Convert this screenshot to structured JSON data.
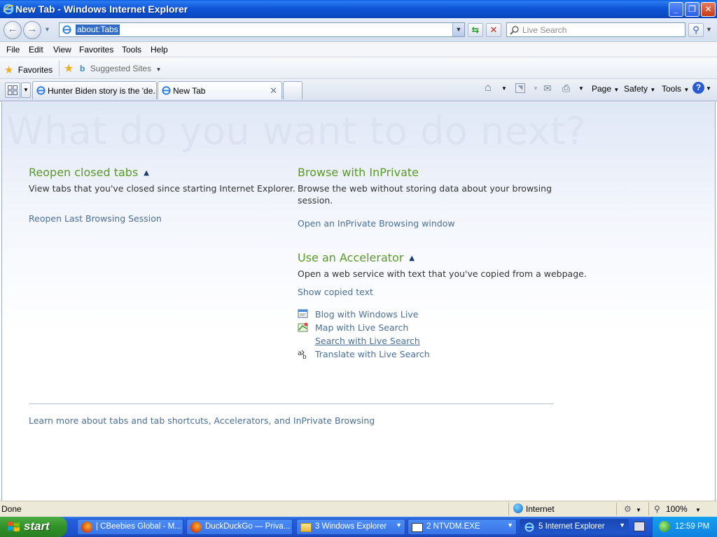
{
  "window": {
    "title": "New Tab - Windows Internet Explorer"
  },
  "address": {
    "url": "about:Tabs"
  },
  "search": {
    "placeholder": "Live Search"
  },
  "menu": [
    "File",
    "Edit",
    "View",
    "Favorites",
    "Tools",
    "Help"
  ],
  "favorites_bar": {
    "favorites_label": "Favorites",
    "suggested_sites": "Suggested Sites"
  },
  "tabs": [
    {
      "label": "Hunter Biden story is the 'de...",
      "active": false
    },
    {
      "label": "New Tab",
      "active": true
    }
  ],
  "commandbar": {
    "page": "Page",
    "safety": "Safety",
    "tools": "Tools"
  },
  "content": {
    "heading": "What do you want to do next?",
    "reopen": {
      "title": "Reopen closed tabs",
      "text": "View tabs that you've closed since starting Internet Explorer.",
      "link": "Reopen Last Browsing Session"
    },
    "inprivate": {
      "title": "Browse with InPrivate",
      "text_line1": "Browse the web without storing data about your browsing",
      "text_line2": "session.",
      "link": "Open an InPrivate Browsing window"
    },
    "accelerator": {
      "title": "Use an Accelerator",
      "text": "Open a web service with text that you've copied from a webpage.",
      "show_copied": "Show copied text",
      "items": [
        {
          "label": "Blog with Windows Live",
          "icon": "blog-icon"
        },
        {
          "label": "Map with Live Search",
          "icon": "map-icon"
        },
        {
          "label": "Search with Live Search",
          "icon": "search-icon"
        },
        {
          "label": "Translate with Live Search",
          "icon": "translate-icon"
        }
      ]
    },
    "learn_more": "Learn more about tabs and tab shortcuts, Accelerators, and InPrivate Browsing"
  },
  "status": {
    "text": "Done",
    "zone": "Internet",
    "zoom": "100%"
  },
  "taskbar": {
    "start": "start",
    "items": [
      {
        "label": "| CBeebies Global - M...",
        "icon": "firefox-icon"
      },
      {
        "label": "DuckDuckGo — Priva...",
        "icon": "firefox-icon"
      },
      {
        "label": "3 Windows Explorer",
        "icon": "folder-icon"
      },
      {
        "label": "2 NTVDM.EXE",
        "icon": "console-icon"
      },
      {
        "label": "5 Internet Explorer",
        "icon": "ie-icon"
      }
    ],
    "clock": "12:59 PM"
  },
  "colors": {
    "section_heading": "#5a9a26",
    "link": "#4a6f98",
    "title_bar": "#0a4cc8",
    "taskbar": "#2156d6",
    "start_button": "#2f8f27"
  }
}
